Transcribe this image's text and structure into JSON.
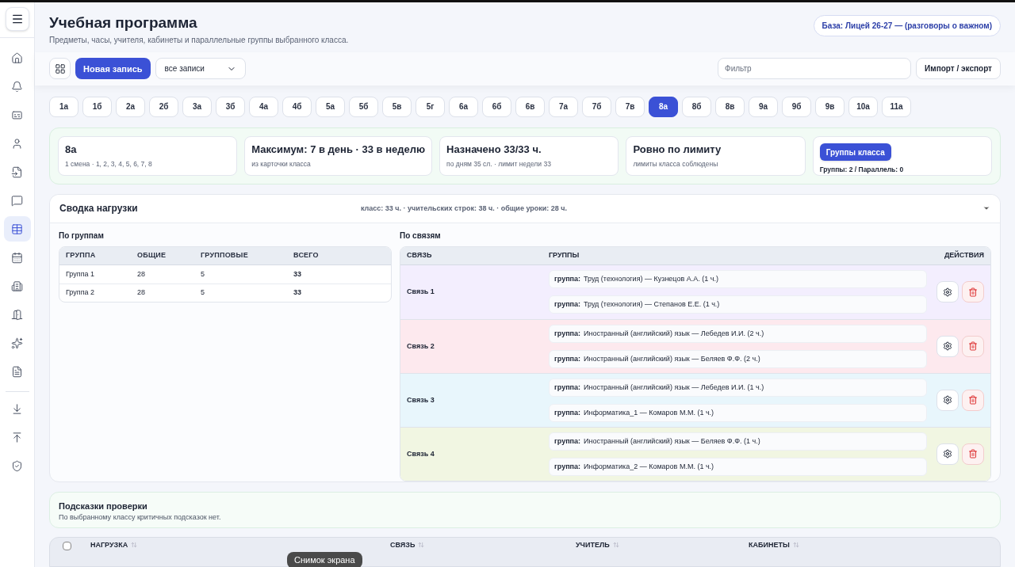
{
  "sidebar": {
    "items": [
      {
        "selected": false
      },
      {
        "selected": false
      },
      {
        "selected": false
      },
      {
        "selected": false
      },
      {
        "selected": false
      },
      {
        "selected": false
      },
      {
        "selected": true
      },
      {
        "selected": false
      },
      {
        "selected": false
      },
      {
        "selected": false
      },
      {
        "selected": false
      },
      {
        "selected": false
      },
      {
        "selected": false
      },
      {
        "selected": false
      },
      {
        "selected": false
      }
    ]
  },
  "header": {
    "title": "Учебная программа",
    "subtitle": "Предметы, часы, учителя, кабинеты и параллельные группы выбранного класса.",
    "base_badge": "База: Лицей 26-27 — (разговоры о важном)"
  },
  "toolbar": {
    "new_button": "Новая запись",
    "view_select": "все записи",
    "filter": {
      "placeholder": "Фильтр"
    },
    "import_button": "Импорт / экспорт"
  },
  "classes": [
    {
      "label": "1а",
      "selected": false
    },
    {
      "label": "1б",
      "selected": false
    },
    {
      "label": "2а",
      "selected": false
    },
    {
      "label": "2б",
      "selected": false
    },
    {
      "label": "3а",
      "selected": false
    },
    {
      "label": "3б",
      "selected": false
    },
    {
      "label": "4а",
      "selected": false
    },
    {
      "label": "4б",
      "selected": false
    },
    {
      "label": "5а",
      "selected": false
    },
    {
      "label": "5б",
      "selected": false
    },
    {
      "label": "5в",
      "selected": false
    },
    {
      "label": "5г",
      "selected": false
    },
    {
      "label": "6а",
      "selected": false
    },
    {
      "label": "6б",
      "selected": false
    },
    {
      "label": "6в",
      "selected": false
    },
    {
      "label": "7а",
      "selected": false
    },
    {
      "label": "7б",
      "selected": false
    },
    {
      "label": "7в",
      "selected": false
    },
    {
      "label": "8а",
      "selected": true
    },
    {
      "label": "8б",
      "selected": false
    },
    {
      "label": "8в",
      "selected": false
    },
    {
      "label": "9а",
      "selected": false
    },
    {
      "label": "9б",
      "selected": false
    },
    {
      "label": "9в",
      "selected": false
    },
    {
      "label": "10а",
      "selected": false
    },
    {
      "label": "11а",
      "selected": false
    }
  ],
  "summary_cards": [
    {
      "kind": "info",
      "title": "8а",
      "subtitle": "1 смена · 1, 2, 3, 4, 5, 6, 7, 8"
    },
    {
      "kind": "info",
      "title": "Максимум: 7 в день · 33 в неделю",
      "subtitle": "из карточки класса"
    },
    {
      "kind": "info",
      "title": "Назначено 33/33 ч.",
      "subtitle": "по дням 35 сл. · лимит недели 33"
    },
    {
      "kind": "info",
      "title": "Ровно по лимиту",
      "subtitle": "лимиты класса соблюдены"
    },
    {
      "kind": "action",
      "button": "Группы класса",
      "text": "Группы: 2 / Параллель: 0"
    }
  ],
  "load_summary": {
    "title": "Сводка нагрузки",
    "stats": "класс: 33 ч. · учительских строк: 38 ч. · общие уроки: 28 ч.",
    "by_groups": {
      "title": "По группам",
      "columns": [
        "ГРУППА",
        "ОБЩИЕ",
        "ГРУППОВЫЕ",
        "ВСЕГО"
      ],
      "rows": [
        [
          "Группа 1",
          "28",
          "5",
          "33"
        ],
        [
          "Группа 2",
          "28",
          "5",
          "33"
        ]
      ]
    },
    "by_links": {
      "title": "По связям",
      "columns": [
        "СВЯЗЬ",
        "ГРУППЫ",
        "ДЕЙСТВИЯ"
      ],
      "rows": [
        {
          "name": "Связь 1",
          "color": "#f3eefe",
          "groups": [
            {
              "label": "группа:",
              "text": "Труд (технология) — Кузнецов А.А. (1 ч.)"
            },
            {
              "label": "группа:",
              "text": "Труд (технология) — Степанов Е.Е. (1 ч.)"
            }
          ]
        },
        {
          "name": "Связь 2",
          "color": "#fde9ee",
          "groups": [
            {
              "label": "группа:",
              "text": "Иностранный (английский) язык — Лебедев И.И. (2 ч.)"
            },
            {
              "label": "группа:",
              "text": "Иностранный (английский) язык — Беляев Ф.Ф. (2 ч.)"
            }
          ]
        },
        {
          "name": "Связь 3",
          "color": "#e8f6fc",
          "groups": [
            {
              "label": "группа:",
              "text": "Иностранный (английский) язык — Лебедев И.И. (1 ч.)"
            },
            {
              "label": "группа:",
              "text": "Информатика_1 — Комаров М.М. (1 ч.)"
            }
          ]
        },
        {
          "name": "Связь 4",
          "color": "#f1f6e2",
          "groups": [
            {
              "label": "группа:",
              "text": "Иностранный (английский) язык — Беляев Ф.Ф. (1 ч.)"
            },
            {
              "label": "группа:",
              "text": "Информатика_2 — Комаров М.М. (1 ч.)"
            }
          ]
        }
      ]
    }
  },
  "hints": {
    "title": "Подсказки проверки",
    "text": "По выбранному классу критичных подсказок нет."
  },
  "bottom_table": {
    "select_all": {
      "checked": false
    },
    "columns": [
      "НАГРУЗКА",
      "СВЯЗЬ",
      "УЧИТЕЛЬ",
      "КАБИНЕТЫ"
    ]
  },
  "tooltip": "Снимок экрана"
}
